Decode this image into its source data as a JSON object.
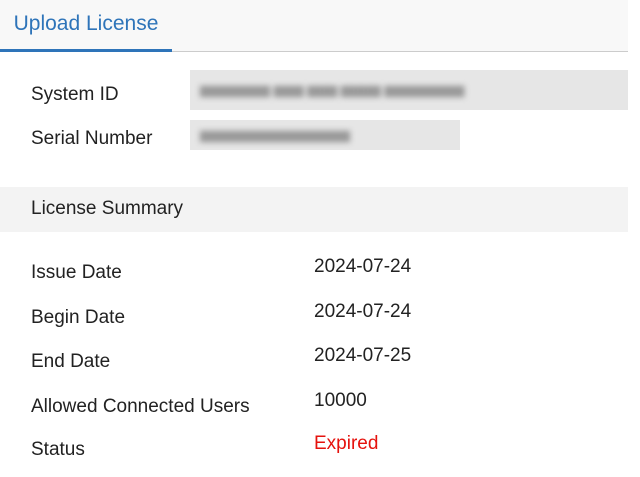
{
  "tab": {
    "label": "Upload License"
  },
  "system": {
    "system_id_label": "System ID",
    "serial_label": "Serial Number"
  },
  "summary": {
    "title": "License Summary",
    "rows": [
      {
        "label": "Issue Date",
        "value": "2024-07-24"
      },
      {
        "label": "Begin Date",
        "value": "2024-07-24"
      },
      {
        "label": "End Date",
        "value": "2024-07-25"
      },
      {
        "label": "Allowed Connected Users",
        "value": "10000"
      },
      {
        "label": "Status",
        "value": "Expired"
      }
    ]
  },
  "colors": {
    "accent": "#2e74b9",
    "expired": "#e5120d"
  }
}
